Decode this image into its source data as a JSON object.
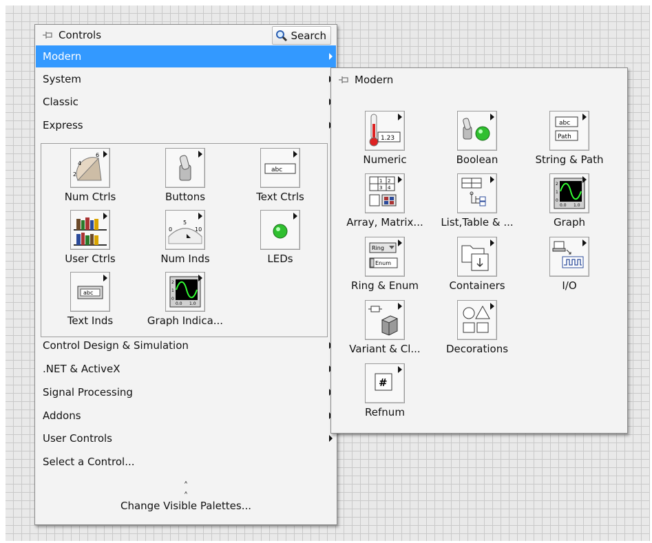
{
  "controls_palette": {
    "title": "Controls",
    "search_label": "Search",
    "menu": [
      {
        "label": "Modern",
        "has_submenu": true,
        "selected": true
      },
      {
        "label": "System",
        "has_submenu": true
      },
      {
        "label": "Classic",
        "has_submenu": true
      },
      {
        "label": "Express",
        "has_submenu": true
      }
    ],
    "express_items": [
      {
        "label": "Num Ctrls",
        "icon": "knob-icon"
      },
      {
        "label": "Buttons",
        "icon": "toggle-switch-icon"
      },
      {
        "label": "Text Ctrls",
        "icon": "string-control-icon"
      },
      {
        "label": "User Ctrls",
        "icon": "books-icon"
      },
      {
        "label": "Num Inds",
        "icon": "meter-icon"
      },
      {
        "label": "LEDs",
        "icon": "led-icon"
      },
      {
        "label": "Text Inds",
        "icon": "string-indicator-icon"
      },
      {
        "label": "Graph Indica...",
        "icon": "graph-icon"
      }
    ],
    "menu_bottom": [
      {
        "label": "Control Design & Simulation",
        "has_submenu": true
      },
      {
        "label": ".NET & ActiveX",
        "has_submenu": true
      },
      {
        "label": "Signal Processing",
        "has_submenu": true
      },
      {
        "label": "Addons",
        "has_submenu": true
      },
      {
        "label": "User Controls",
        "has_submenu": true
      },
      {
        "label": "Select a Control...",
        "has_submenu": false
      }
    ],
    "change_palettes_label": "Change Visible Palettes..."
  },
  "modern_palette": {
    "title": "Modern",
    "items": [
      {
        "label": "Numeric",
        "icon": "thermometer-numeric-icon"
      },
      {
        "label": "Boolean",
        "icon": "boolean-led-icon"
      },
      {
        "label": "String & Path",
        "icon": "string-path-icon"
      },
      {
        "label": "Array, Matrix...",
        "icon": "array-matrix-icon"
      },
      {
        "label": "List,Table & ...",
        "icon": "list-table-icon"
      },
      {
        "label": "Graph",
        "icon": "graph-icon"
      },
      {
        "label": "Ring & Enum",
        "icon": "ring-enum-icon"
      },
      {
        "label": "Containers",
        "icon": "containers-icon"
      },
      {
        "label": "I/O",
        "icon": "io-icon"
      },
      {
        "label": "Variant & Cl...",
        "icon": "variant-class-icon"
      },
      {
        "label": "Decorations",
        "icon": "decorations-icon"
      },
      {
        "label": "Refnum",
        "icon": "refnum-icon"
      }
    ]
  },
  "text": {
    "abc": "abc",
    "path": "Path",
    "num": "1.23",
    "ring": "Ring",
    "enum": "Enum",
    "hash": "#",
    "knob_ticks": [
      "2",
      "4",
      "6"
    ],
    "meter_ticks": [
      "0",
      "5",
      "10"
    ],
    "matrix_cells": [
      "1",
      "2",
      "3",
      "4"
    ],
    "graph_ticks": [
      "2",
      "1",
      "0",
      "0.0",
      "1.0"
    ]
  },
  "colors": {
    "selection": "#3399ff",
    "led_green": "#2fbf2f",
    "graph_bg": "#000000",
    "graph_trace": "#33ff33"
  }
}
